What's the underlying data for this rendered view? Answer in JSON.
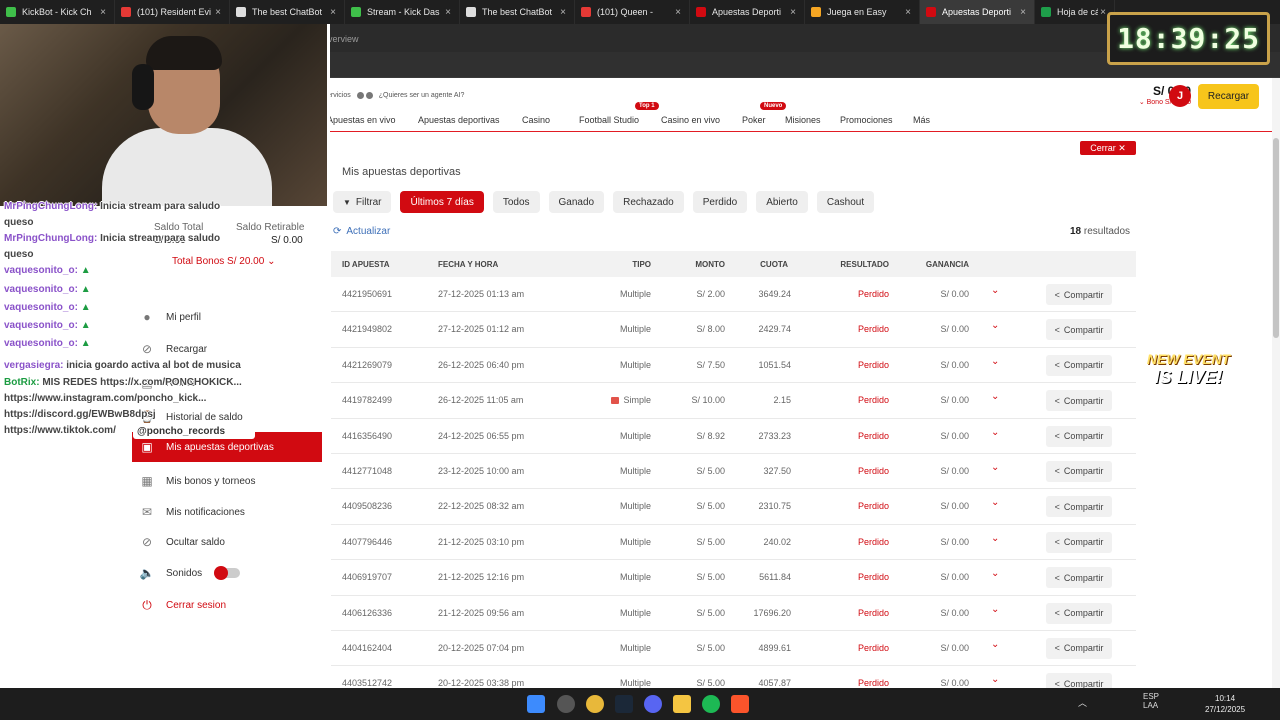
{
  "browser": {
    "tabs": [
      {
        "label": "KickBot - Kick Ch",
        "color": "#3fbf4a"
      },
      {
        "label": "(101) Resident Evi",
        "color": "#e53935"
      },
      {
        "label": "The best ChatBot",
        "color": "#dddddd"
      },
      {
        "label": "Stream - Kick Das",
        "color": "#3fbf4a"
      },
      {
        "label": "The best ChatBot",
        "color": "#dddddd"
      },
      {
        "label": "(101) Queen -",
        "color": "#e53935"
      },
      {
        "label": "Apuestas Deporti",
        "color": "#d10a11"
      },
      {
        "label": "Juega en Easy",
        "color": "#f5a623"
      },
      {
        "label": "Apuestas Deporti",
        "color": "#d10a11"
      },
      {
        "label": "Hoja de cálculo",
        "color": "#1e9e4a"
      }
    ],
    "address_fragment": "verview"
  },
  "site": {
    "topline": "¿Quieres ser un agente AI?",
    "topline_prefix": "ervicios",
    "nav": [
      {
        "label": "Apuestas en vivo",
        "badge": ""
      },
      {
        "label": "Apuestas deportivas",
        "badge": ""
      },
      {
        "label": "Casino",
        "badge": ""
      },
      {
        "label": "Football Studio",
        "badge": "Top 1"
      },
      {
        "label": "Casino en vivo",
        "badge": ""
      },
      {
        "label": "Poker",
        "badge": "Nuevo"
      },
      {
        "label": "Misiones",
        "badge": ""
      },
      {
        "label": "Promociones",
        "badge": ""
      },
      {
        "label": "Más",
        "badge": ""
      }
    ],
    "balance": "S/ 0.00",
    "bono": "Bono S/ 20.00",
    "avatar_letter": "J",
    "recargar": "Recargar",
    "cerrar": "Cerrar ✕"
  },
  "bets": {
    "title": "Mis apuestas deportivas",
    "filter_label": "Filtrar",
    "chips": [
      "Últimos 7 días",
      "Todos",
      "Ganado",
      "Rechazado",
      "Perdido",
      "Abierto",
      "Cashout"
    ],
    "active_chip": "Últimos 7 días",
    "actualizar": "Actualizar",
    "results_count": "18",
    "results_label": "resultados",
    "columns": {
      "id": "ID APUESTA",
      "fecha": "FECHA Y HORA",
      "tipo": "TIPO",
      "monto": "MONTO",
      "cuota": "CUOTA",
      "resultado": "RESULTADO",
      "ganancia": "GANANCIA"
    },
    "share_label": "Compartir",
    "rows": [
      {
        "id": "4421950691",
        "fecha": "27-12-2025 01:13 am",
        "tipo": "Multiple",
        "monto": "S/ 2.00",
        "cuota": "3649.24",
        "resultado": "Perdido",
        "ganancia": "S/ 0.00"
      },
      {
        "id": "4421949802",
        "fecha": "27-12-2025 01:12 am",
        "tipo": "Multiple",
        "monto": "S/ 8.00",
        "cuota": "2429.74",
        "resultado": "Perdido",
        "ganancia": "S/ 0.00"
      },
      {
        "id": "4421269079",
        "fecha": "26-12-2025 06:40 pm",
        "tipo": "Multiple",
        "monto": "S/ 7.50",
        "cuota": "1051.54",
        "resultado": "Perdido",
        "ganancia": "S/ 0.00"
      },
      {
        "id": "4419782499",
        "fecha": "26-12-2025 11:05 am",
        "tipo": "Simple",
        "monto": "S/ 10.00",
        "cuota": "2.15",
        "resultado": "Perdido",
        "ganancia": "S/ 0.00"
      },
      {
        "id": "4416356490",
        "fecha": "24-12-2025 06:55 pm",
        "tipo": "Multiple",
        "monto": "S/ 8.92",
        "cuota": "2733.23",
        "resultado": "Perdido",
        "ganancia": "S/ 0.00"
      },
      {
        "id": "4412771048",
        "fecha": "23-12-2025 10:00 am",
        "tipo": "Multiple",
        "monto": "S/ 5.00",
        "cuota": "327.50",
        "resultado": "Perdido",
        "ganancia": "S/ 0.00"
      },
      {
        "id": "4409508236",
        "fecha": "22-12-2025 08:32 am",
        "tipo": "Multiple",
        "monto": "S/ 5.00",
        "cuota": "2310.75",
        "resultado": "Perdido",
        "ganancia": "S/ 0.00"
      },
      {
        "id": "4407796446",
        "fecha": "21-12-2025 03:10 pm",
        "tipo": "Multiple",
        "monto": "S/ 5.00",
        "cuota": "240.02",
        "resultado": "Perdido",
        "ganancia": "S/ 0.00"
      },
      {
        "id": "4406919707",
        "fecha": "21-12-2025 12:16 pm",
        "tipo": "Multiple",
        "monto": "S/ 5.00",
        "cuota": "5611.84",
        "resultado": "Perdido",
        "ganancia": "S/ 0.00"
      },
      {
        "id": "4406126336",
        "fecha": "21-12-2025 09:56 am",
        "tipo": "Multiple",
        "monto": "S/ 5.00",
        "cuota": "17696.20",
        "resultado": "Perdido",
        "ganancia": "S/ 0.00"
      },
      {
        "id": "4404162404",
        "fecha": "20-12-2025 07:04 pm",
        "tipo": "Multiple",
        "monto": "S/ 5.00",
        "cuota": "4899.61",
        "resultado": "Perdido",
        "ganancia": "S/ 0.00"
      },
      {
        "id": "4403512742",
        "fecha": "20-12-2025 03:38 pm",
        "tipo": "Multiple",
        "monto": "S/ 5.00",
        "cuota": "4057.87",
        "resultado": "Perdido",
        "ganancia": "S/ 0.00"
      }
    ]
  },
  "account_menu": {
    "saldo_total_label": "Saldo Total",
    "saldo_retirable_label": "Saldo Retirable",
    "saldo_total_value": "S/ 0.00",
    "saldo_retirable_value": "S/ 0.00",
    "total_bonos": "Total Bonos S/ 20.00",
    "items": [
      {
        "label": "Mi perfil",
        "icon": "user-icon"
      },
      {
        "label": "Recargar",
        "icon": "refresh-icon"
      },
      {
        "label": "Retirar",
        "icon": "withdraw-icon"
      },
      {
        "label": "Historial de saldo",
        "icon": "history-icon"
      },
      {
        "label": "Mis apuestas deportivas",
        "icon": "bets-icon"
      },
      {
        "label": "Mis bonos y torneos",
        "icon": "gift-icon"
      },
      {
        "label": "Mis notificaciones",
        "icon": "mail-icon"
      },
      {
        "label": "Ocultar saldo",
        "icon": "eye-off-icon"
      },
      {
        "label": "Sonidos",
        "icon": "speaker-icon"
      },
      {
        "label": "Cerrar sesion",
        "icon": "power-icon"
      }
    ]
  },
  "chat": {
    "lines": [
      {
        "user": "MrPingChungLong:",
        "text": "Inicia stream para saludo",
        "kind": "purple"
      },
      {
        "user": "",
        "text": "queso",
        "kind": "msg"
      },
      {
        "user": "MrPingChungLong:",
        "text": "Inicia stream para saludo",
        "kind": "purple"
      },
      {
        "user": "",
        "text": "queso",
        "kind": "msg"
      },
      {
        "user": "vaquesonito_o:",
        "text": "",
        "kind": "purple"
      },
      {
        "user": "vaquesonito_o:",
        "text": "",
        "kind": "purple"
      },
      {
        "user": "vaquesonito_o:",
        "text": "",
        "kind": "purple"
      },
      {
        "user": "vaquesonito_o:",
        "text": "",
        "kind": "purple"
      },
      {
        "user": "vaquesonito_o:",
        "text": "",
        "kind": "purple"
      },
      {
        "user": "vergasiegra:",
        "text": "inicia goardo activa al bot de musica",
        "kind": "purple"
      },
      {
        "user": "BotRix:",
        "text": "MIS REDES https://x.com/PONCHOKICK...",
        "kind": "green"
      },
      {
        "user": "",
        "text": "https://www.instagram.com/poncho_kick...",
        "kind": "msg"
      },
      {
        "user": "",
        "text": "https://discord.gg/EWBwB8dpsj",
        "kind": "msg"
      },
      {
        "user": "",
        "text": "https://www.tiktok.com/",
        "kind": "msg"
      }
    ],
    "tag": "@poncho_records"
  },
  "overlay": {
    "clock": "18:39:25",
    "new_event_l1": "NEW EVENT",
    "new_event_l2": "IS LIVE!"
  },
  "taskbar": {
    "lang": "ESP",
    "lang2": "LAA",
    "time": "10:14",
    "date": "27/12/2025"
  }
}
